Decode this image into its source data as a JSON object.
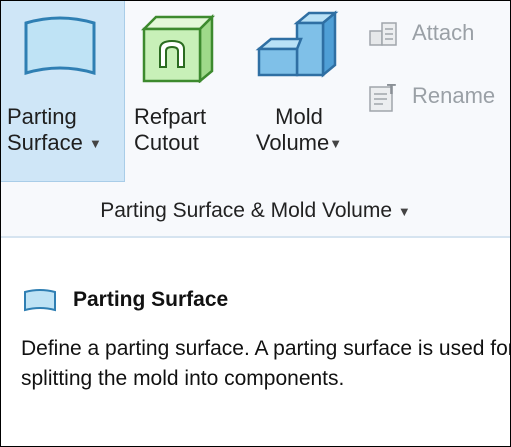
{
  "ribbon": {
    "parting_surface": {
      "line1": "Parting",
      "line2": "Surface"
    },
    "refpart_cutout": {
      "line1": "Refpart",
      "line2": "Cutout"
    },
    "mold_volume": {
      "line1": "Mold",
      "line2": "Volume"
    },
    "attach_label": "Attach",
    "rename_label": "Rename",
    "group_label": "Parting Surface & Mold Volume",
    "dropdown_arrow": "▼"
  },
  "tooltip": {
    "title": "Parting Surface",
    "description": "Define a parting surface. A parting surface is used for splitting the mold into components."
  },
  "colors": {
    "selected_bg": "#cfe6f7",
    "surface_icon_fill": "#bfe3f5",
    "surface_icon_stroke": "#2f7fb3",
    "cutout_icon_fill": "#c8f0b8",
    "cutout_icon_stroke": "#3d8a2e",
    "volume_icon_fill": "#7fc0e8",
    "volume_icon_stroke": "#2f6fa3",
    "disabled_text": "#9aa0a6"
  }
}
